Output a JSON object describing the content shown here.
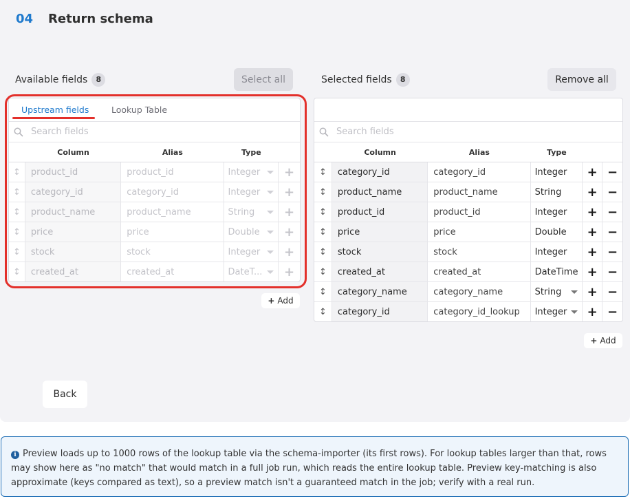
{
  "step": {
    "number": "04",
    "title": "Return schema"
  },
  "available": {
    "label": "Available fields",
    "count": "8",
    "select_all_label": "Select all",
    "tabs": [
      {
        "label": "Upstream fields",
        "active": true
      },
      {
        "label": "Lookup Table",
        "active": false
      }
    ],
    "search_placeholder": "Search fields",
    "headers": {
      "column": "Column",
      "alias": "Alias",
      "type": "Type"
    },
    "rows": [
      {
        "column": "product_id",
        "alias": "product_id",
        "type": "Integer"
      },
      {
        "column": "category_id",
        "alias": "category_id",
        "type": "Integer"
      },
      {
        "column": "product_name",
        "alias": "product_name",
        "type": "String"
      },
      {
        "column": "price",
        "alias": "price",
        "type": "Double"
      },
      {
        "column": "stock",
        "alias": "stock",
        "type": "Integer"
      },
      {
        "column": "created_at",
        "alias": "created_at",
        "type": "DateT..."
      }
    ],
    "add_label": "Add"
  },
  "selected": {
    "label": "Selected fields",
    "count": "8",
    "remove_all_label": "Remove all",
    "search_placeholder": "Search fields",
    "headers": {
      "column": "Column",
      "alias": "Alias",
      "type": "Type"
    },
    "rows": [
      {
        "column": "category_id",
        "alias": "category_id",
        "type": "Integer",
        "dropdown": false
      },
      {
        "column": "product_name",
        "alias": "product_name",
        "type": "String",
        "dropdown": false
      },
      {
        "column": "product_id",
        "alias": "product_id",
        "type": "Integer",
        "dropdown": false
      },
      {
        "column": "price",
        "alias": "price",
        "type": "Double",
        "dropdown": false
      },
      {
        "column": "stock",
        "alias": "stock",
        "type": "Integer",
        "dropdown": false
      },
      {
        "column": "created_at",
        "alias": "created_at",
        "type": "DateTime",
        "dropdown": false
      },
      {
        "column": "category_name",
        "alias": "category_name",
        "type": "String",
        "dropdown": true
      },
      {
        "column": "category_id",
        "alias": "category_id_lookup",
        "type": "Integer",
        "dropdown": true
      }
    ],
    "add_label": "Add"
  },
  "back_label": "Back",
  "info_text": "Preview loads up to 1000 rows of the lookup table via the schema-importer (its first rows). For lookup tables larger than that, rows may show here as \"no match\" that would match in a full job run, which reads the entire lookup table. Preview key-matching is also approximate (keys compared as text), so a preview match isn't a guaranteed match in the job; verify with a real run.",
  "colors": {
    "accent": "#1f7acd",
    "annotation": "#e3302b",
    "info_border": "#1f6fb6"
  }
}
